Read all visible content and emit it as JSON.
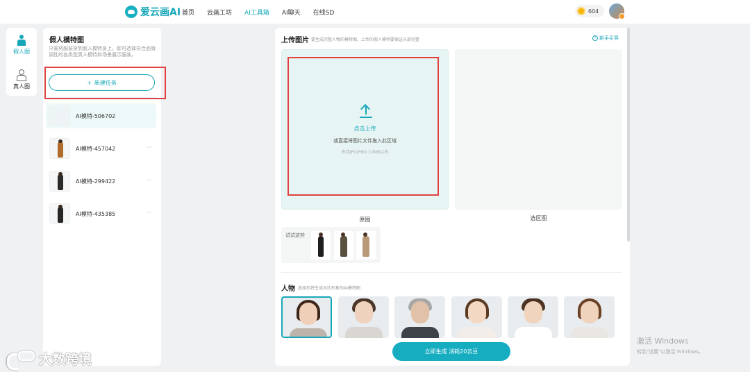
{
  "app": {
    "logo": "爱云画AI",
    "nav": [
      "首页",
      "云画工坊",
      "AI工具箱",
      "AI聊天",
      "在线SD"
    ],
    "coins": "604"
  },
  "rail": {
    "items": [
      {
        "label": "假人图",
        "icon": "mannequin-icon"
      },
      {
        "label": "真人图",
        "icon": "person-icon"
      }
    ]
  },
  "task_panel": {
    "title": "假人模特图",
    "description": "只需将服装穿到假人模特身上，即可选择符合品牌调性的各类型真人模特和场景展示服装。",
    "new_task": "新建任务",
    "tasks": [
      {
        "name": "AI模特-506702",
        "more": ""
      },
      {
        "name": "AI模特-457042",
        "more": "···"
      },
      {
        "name": "AI模特-299422",
        "more": "···"
      },
      {
        "name": "AI模特-435385",
        "more": "···"
      }
    ]
  },
  "main": {
    "upload_title": "上传图片",
    "upload_hint": "要生成完整人物的模特图，上传的假人模特要保证头部完整",
    "guide": "新手引导",
    "click_upload": "点击上传",
    "drag_text": "或直接将图片文件拖入此区域",
    "formats": "支持JPG/PNG 10MB以内",
    "original_label": "原图",
    "selection_label": "选区图",
    "try_label": "试试这些",
    "person_title": "人物",
    "person_hint": "选择后将生成对应形象的AI模特图",
    "generate": "立即生成  消耗20云豆"
  },
  "watermark": {
    "brand": "大数跨境",
    "activate_title": "激活 Windows",
    "activate_sub": "转到\"设置\"以激活 Windows。"
  },
  "colors": {
    "accent": "#16a7b8",
    "highlight": "#e24141",
    "upload_bg": "#e7f4f4"
  }
}
